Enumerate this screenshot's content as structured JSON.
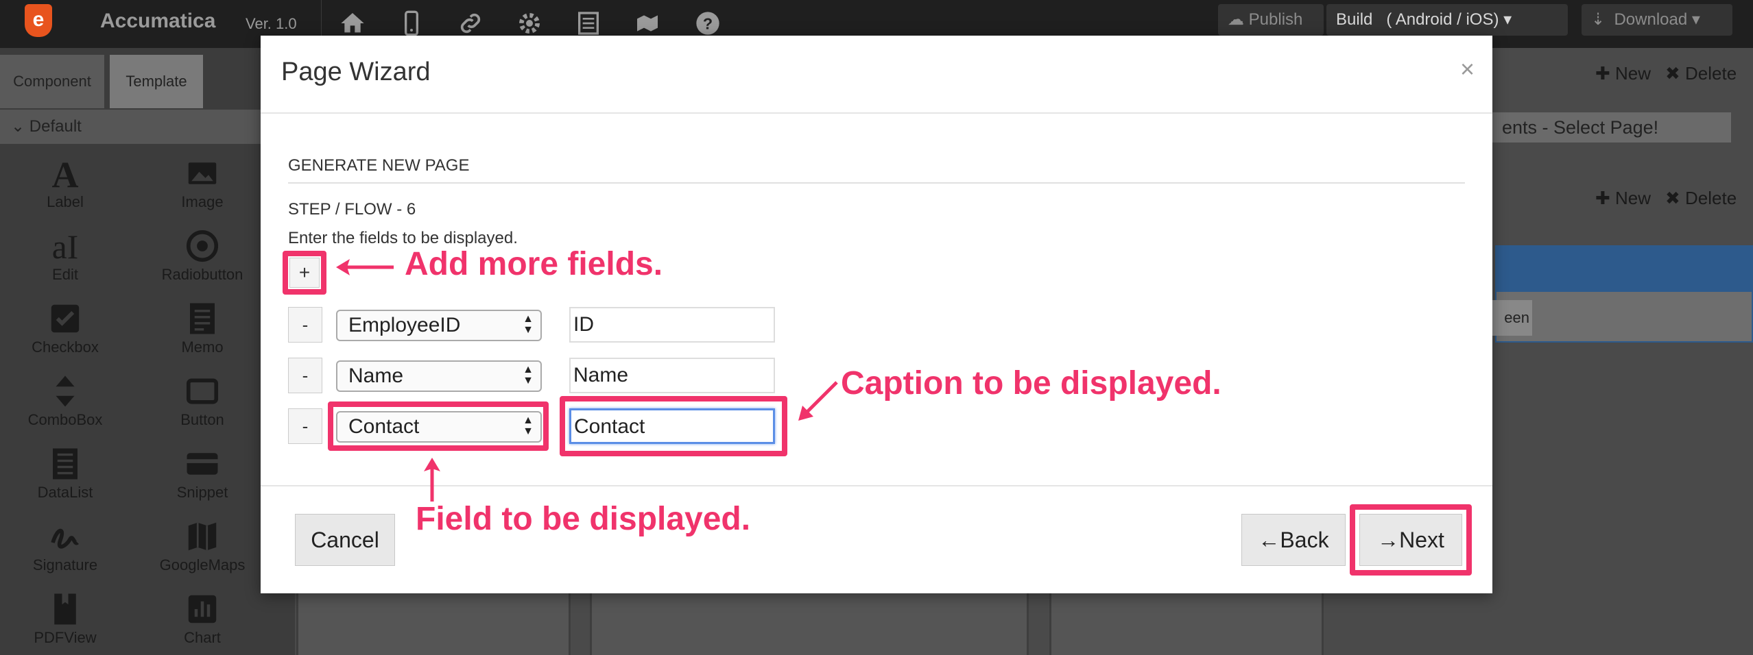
{
  "app": {
    "logo_letter": "e",
    "name": "Accumatica",
    "version": "Ver. 1.0"
  },
  "topbar": {
    "icons": [
      "home-icon",
      "mobile-icon",
      "link-icon",
      "gear-icon",
      "list-icon",
      "map-icon",
      "help-icon"
    ],
    "publish": "Publish",
    "build": "Build",
    "build_targets": "( Android / iOS)",
    "download": "Download"
  },
  "left_panel": {
    "tabs": [
      "Component",
      "Template"
    ],
    "group": "Default",
    "components": [
      "Label",
      "Image",
      "Edit",
      "Radiobutton",
      "Checkbox",
      "Memo",
      "ComboBox",
      "Button",
      "DataList",
      "Snippet",
      "Signature",
      "GoogleMaps",
      "PDFView",
      "Chart"
    ]
  },
  "right_panel": {
    "new_label": "New",
    "delete_label": "Delete",
    "select_page": "ents - Select Page!",
    "screen_label": "een"
  },
  "modal": {
    "title": "Page Wizard",
    "close": "×",
    "section": "GENERATE NEW PAGE",
    "step": "STEP / FLOW - 6",
    "instruction": "Enter the fields to be displayed.",
    "add_label": "+",
    "remove_label": "-",
    "rows": [
      {
        "field": "EmployeeID",
        "caption": "ID"
      },
      {
        "field": "Name",
        "caption": "Name"
      },
      {
        "field": "Contact",
        "caption": "Contact"
      }
    ],
    "cancel": "Cancel",
    "back": "Back",
    "next": "Next"
  },
  "annotations": {
    "add_more": "Add more fields.",
    "caption": "Caption to be displayed.",
    "field": "Field to be displayed."
  },
  "colors": {
    "highlight": "#f0336b",
    "topbar": "#1f1f1f"
  }
}
